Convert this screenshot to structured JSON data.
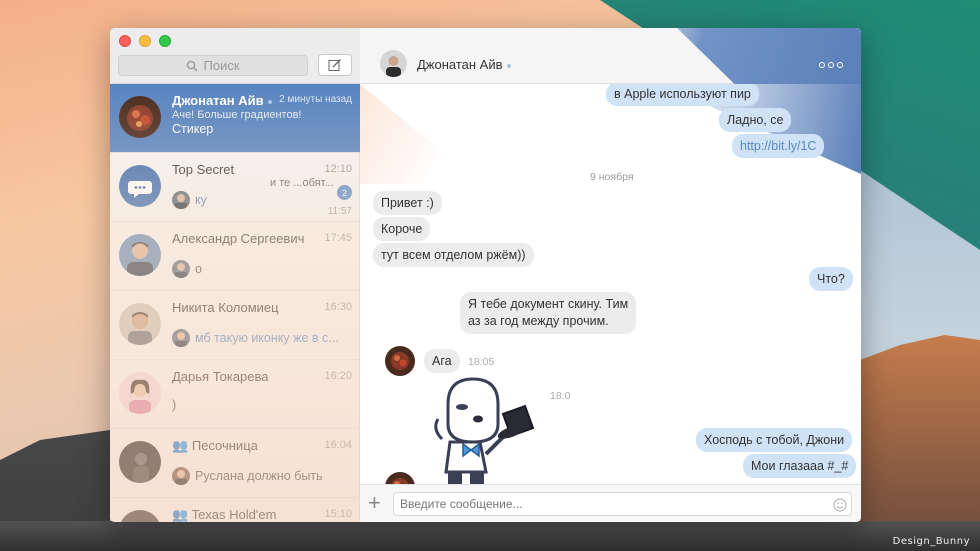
{
  "desktop": {
    "credit": "Design_Bunny"
  },
  "window": {
    "search_placeholder": "Поиск",
    "composer_placeholder": "Введите сообщение..."
  },
  "header": {
    "name": "Джонатан Айв"
  },
  "chats": [
    {
      "name": "Джонатан Айв",
      "time": "2 минуты назад",
      "sub": "Аче! Больше градиентов!",
      "preview": "Стикер",
      "active": true
    },
    {
      "name": "Top Secret",
      "time": "12:10",
      "snippet": "и те ...обят...",
      "badge": "2",
      "time2": "11:57",
      "preview": "ку"
    },
    {
      "name": "Александр Сергеевич",
      "time": "17:45",
      "preview": "о"
    },
    {
      "name": "Никита Коломиец",
      "time": "16:30",
      "preview": "мб такую иконку же в с..."
    },
    {
      "name": "Дарья Токарева",
      "time": "16:20",
      "preview": ")"
    },
    {
      "name": "Песочница",
      "time": "16:04",
      "preview": "Руслана должно быть"
    },
    {
      "name": "Texas Hold'em",
      "time": "15:10"
    }
  ],
  "messages": {
    "m1": "в Apple используют пир",
    "m2": "Ладно, се",
    "m3": "http://bit.ly/1C",
    "date1": "9 ноября",
    "m4": "Привет :)",
    "m5": "Короче",
    "m6": "тут всем отделом ржём))",
    "m7": "Что?",
    "m8a": "Я тебе документ скину. Тим",
    "m8b": "аз за год между прочим.",
    "m9": "Ага",
    "t9": "18:05",
    "t_sticker": "18:0",
    "m10": "Хосподь с тобой, Джони",
    "m11": "Мои глазааа #_#"
  },
  "colors": {
    "accent": "#5785c1",
    "out_bubble": "#cfe2f6",
    "in_bubble": "#ececec"
  }
}
